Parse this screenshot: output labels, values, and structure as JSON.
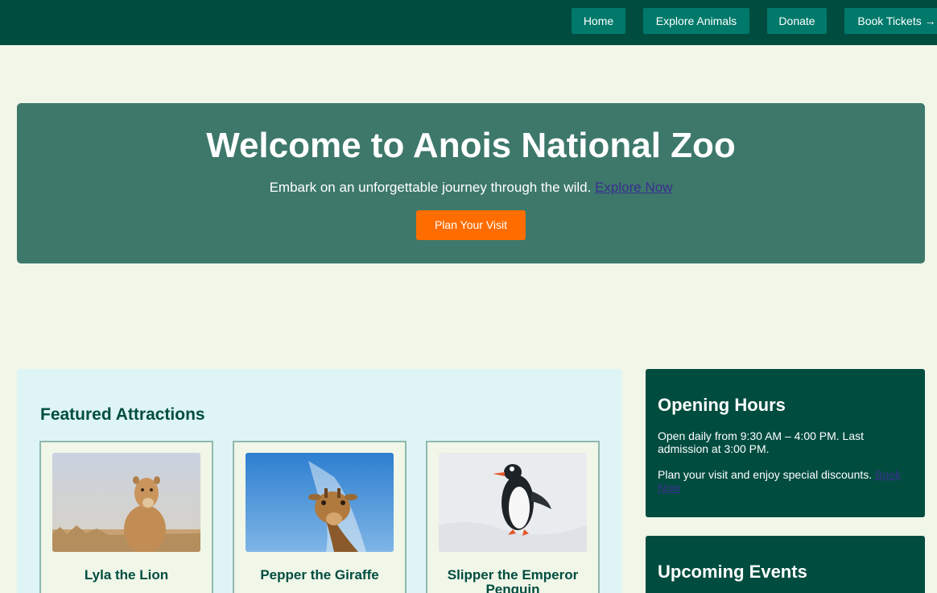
{
  "nav": {
    "home": "Home",
    "explore": "Explore Animals",
    "donate": "Donate",
    "book": "Book Tickets →"
  },
  "hero": {
    "title": "Welcome to Anois National Zoo",
    "subtitle": "Embark on an unforgettable journey through the wild.",
    "explore_link": "Explore Now",
    "cta": "Plan Your Visit"
  },
  "featured": {
    "heading": "Featured Attractions",
    "cards": [
      {
        "title": "Lyla the Lion",
        "image": "lion-photo"
      },
      {
        "title": "Pepper the Giraffe",
        "image": "giraffe-photo"
      },
      {
        "title": "Slipper the Emperor Penguin",
        "image": "penguin-photo"
      }
    ]
  },
  "hours": {
    "heading": "Opening Hours",
    "text": "Open daily from 9:30 AM – 4:00 PM. Last admission at 3:00 PM.",
    "plan_text": "Plan your visit and enjoy special discounts.",
    "book_link": "Book Now"
  },
  "events": {
    "heading": "Upcoming Events"
  },
  "colors": {
    "header": "#004d40",
    "nav_button": "#00796b",
    "hero": "#3d786b",
    "cta": "#ff6d00",
    "page": "#f0f6e8",
    "featured_panel": "#dff5f5"
  }
}
